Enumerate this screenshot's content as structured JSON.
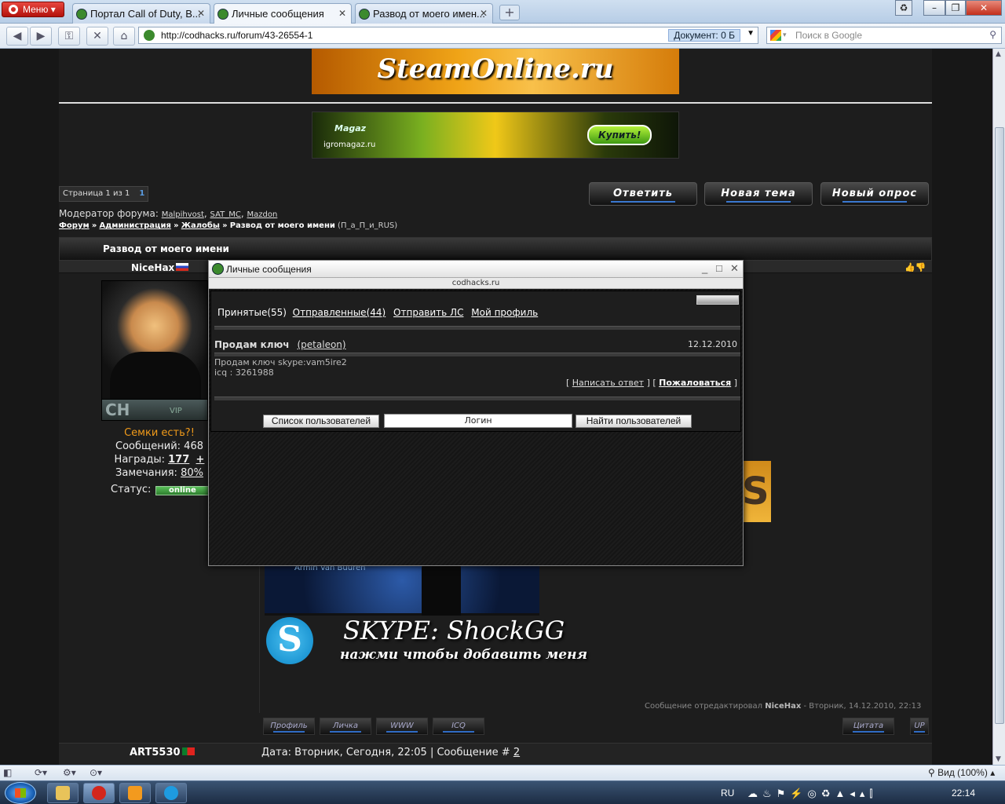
{
  "browser": {
    "menu_label": "Меню",
    "tabs": [
      {
        "title": "Портал Call of Duty, B..."
      },
      {
        "title": "Личные сообщения"
      },
      {
        "title": "Развод от моего имен..."
      }
    ],
    "new_tab_symbol": "+",
    "address": "http://codhacks.ru/forum/43-26554-1",
    "doc_label": "Документ:  0 Б",
    "search_placeholder": "Поиск в Google",
    "status_zoom": "Вид (100%)"
  },
  "page": {
    "banner1_text": "SteamOnline.ru",
    "banner2": {
      "brand": "Magaz",
      "domain": "igromagaz.ru",
      "buy": "Купить!"
    },
    "pager": {
      "label": "Страница 1 из 1",
      "current": "1"
    },
    "buttons": {
      "reply": "Ответить",
      "new_topic": "Новая тема",
      "new_poll": "Новый опрос"
    },
    "moderators": {
      "label": "Модератор форума:",
      "names": [
        "Malpihvost",
        "SAT_MC",
        "Mazdon"
      ]
    },
    "breadcrumbs": {
      "forum": "Форум",
      "admin": "Администрация",
      "complaints": "Жалобы",
      "topic": "Развод от моего имени",
      "author": "(П_а_П_и_RUS)"
    },
    "thread_title": "Развод от моего имени",
    "post1": {
      "nick": "NiceHax",
      "rank_logo": "CH",
      "vip": "VIP",
      "tagline": "Семки есть?!",
      "messages_label": "Сообщений:",
      "messages": "468",
      "awards_label": "Награды:",
      "awards": "177",
      "awards_plus": "+",
      "warnings_label": "Замечания:",
      "warnings": "80%",
      "status_label": "Статус:",
      "status": "online",
      "sig_name": "Armin Van Buuren",
      "skype_line1": "SKYPE: ShockGG",
      "skype_line2": "нажми чтобы добавить меня",
      "edited_prefix": "Сообщение отредактировал",
      "edited_by": "NiceHax",
      "edited_suffix": "- Вторник, 14.12.2010, 22:13",
      "buttons": [
        "Профиль",
        "Личка",
        "WWW",
        "ICQ"
      ],
      "quote": "Цитата",
      "up": "UP"
    },
    "post2": {
      "nick": "ART5530",
      "date": "Дата: Вторник, Сегодня, 22:05 | Сообщение #",
      "num": "2"
    }
  },
  "popup": {
    "title": "Личные сообщения",
    "url": "codhacks.ru",
    "nav": {
      "inbox": "Принятые",
      "inbox_count": "(55)",
      "sent": "Отправленные",
      "sent_count": "(44)",
      "send": "Отправить ЛС",
      "profile": "Мой профиль"
    },
    "message": {
      "subject": "Продам ключ",
      "from": "(petaleon)",
      "date": "12.12.2010",
      "line1": "Продам ключ skype:vam5ire2",
      "line2": "icq : 3261988",
      "reply": "Написать ответ",
      "complain": "Пожаловаться"
    },
    "user_list_button": "Список пользователей",
    "login_placeholder": "Логин",
    "find_button": "Найти пользователей"
  },
  "taskbar": {
    "lang": "RU",
    "time": "22:14"
  }
}
